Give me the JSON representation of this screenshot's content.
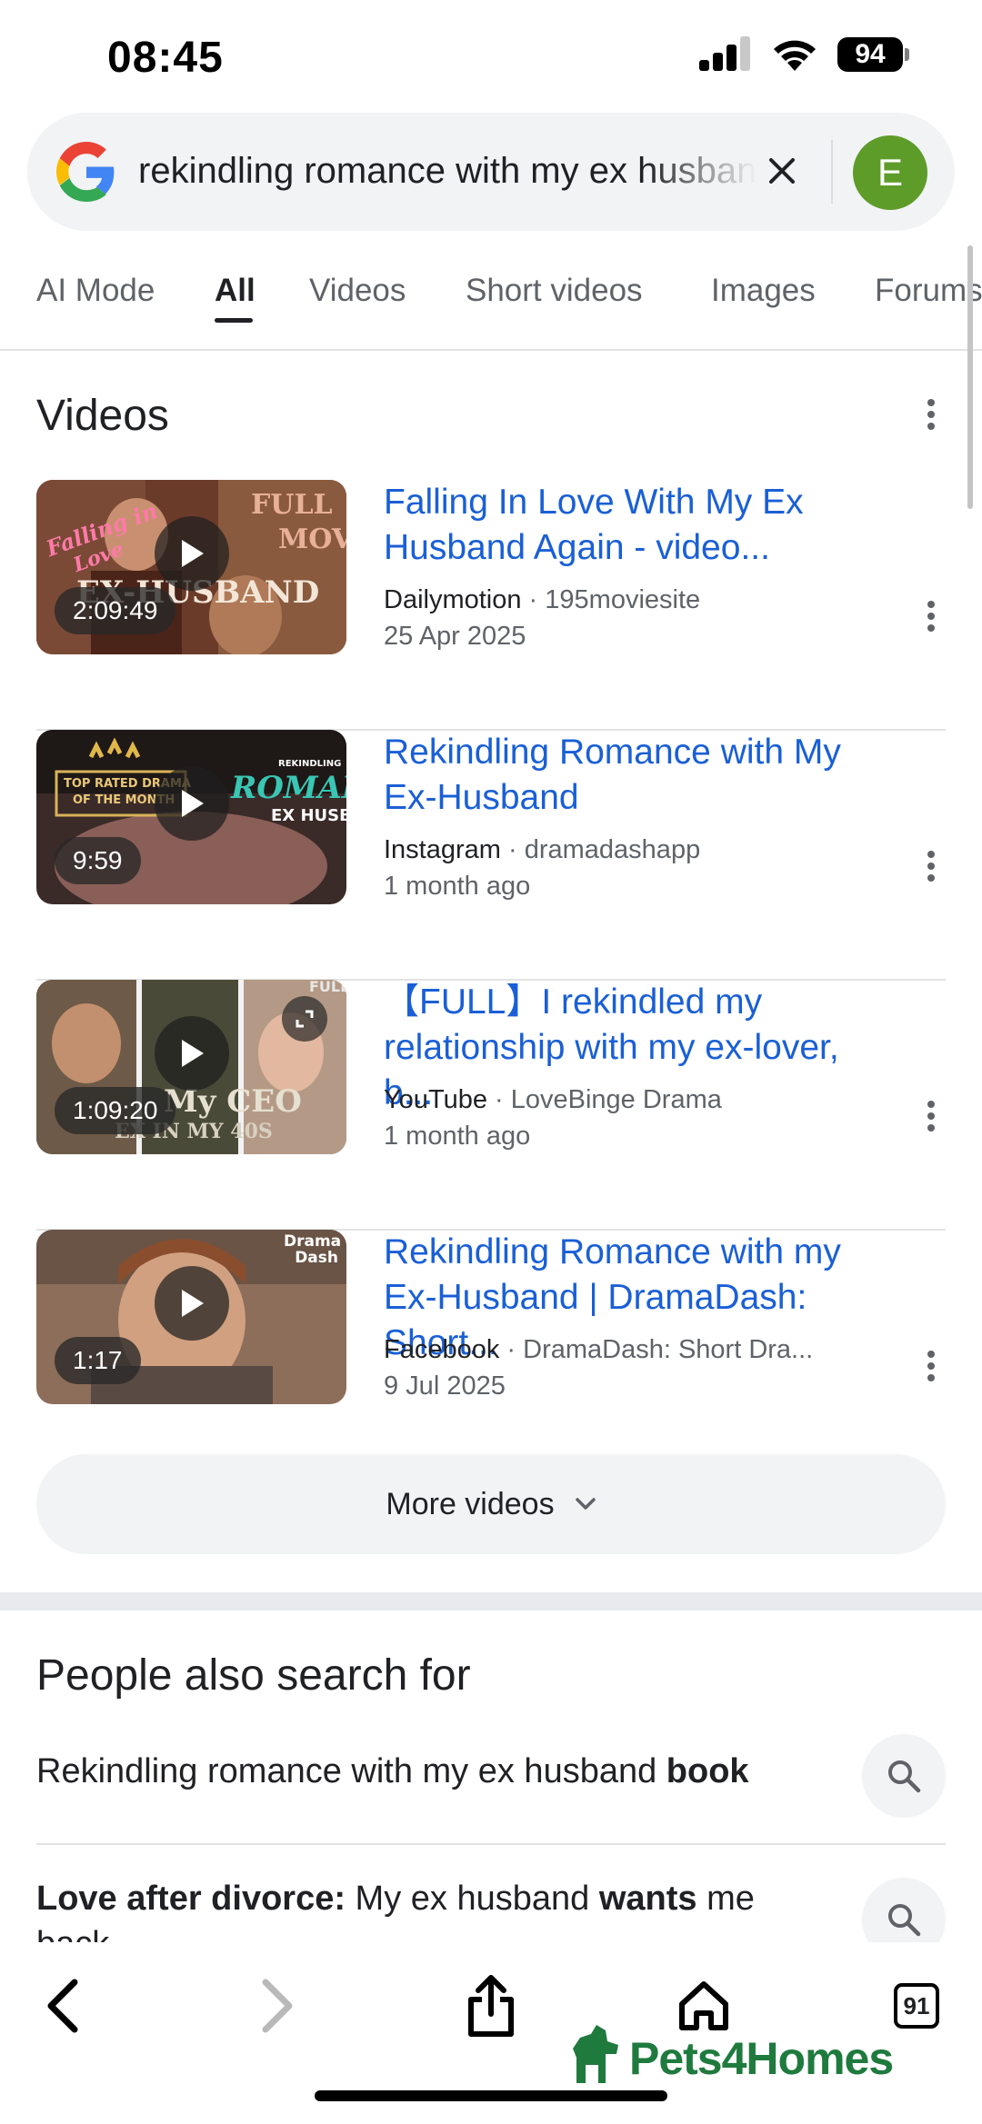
{
  "status_bar": {
    "time": "08:45",
    "battery": "94"
  },
  "search": {
    "query": "rekindling romance with my ex husband",
    "avatar_letter": "E"
  },
  "tabs": [
    "AI Mode",
    "All",
    "Videos",
    "Short videos",
    "Images",
    "Forums"
  ],
  "active_tab": "All",
  "videos_section": {
    "title": "Videos",
    "items": [
      {
        "title": "Falling In Love With My Ex Husband Again - video...",
        "source": "Dailymotion",
        "channel": " · 195moviesite",
        "date": "25 Apr 2025",
        "duration": "2:09:49"
      },
      {
        "title": "Rekindling Romance with My Ex-Husband",
        "source": "Instagram",
        "channel": " · dramadashapp",
        "date": "1 month ago",
        "duration": "9:59"
      },
      {
        "title": "【FULL】I rekindled my relationship with my ex-lover, b...",
        "source": "YouTube",
        "channel": " · LoveBinge Drama",
        "date": "1 month ago",
        "duration": "1:09:20"
      },
      {
        "title": "Rekindling Romance with my Ex-Husband | DramaDash: Short...",
        "source": "Facebook",
        "channel": " · DramaDash: Short Dra...",
        "date": "9 Jul 2025",
        "duration": "1:17"
      }
    ],
    "more_label": "More videos"
  },
  "thumb_text": {
    "t1_falling": "Falling in",
    "t1_love": "Love",
    "t1_full": "FULL",
    "t1_movie": "MOVIE",
    "t1_ex": "EX-HUSBAND",
    "t2_top": "TOP RATED DRAMA",
    "t2_month": "OF THE MONTH",
    "t2_rekindling": "REKINDLING",
    "t2_romance": "ROMANCE",
    "t2_ex": "EX HUSBAND",
    "t3_full": "FULL",
    "t3_ceo": "My CEO",
    "t3_ex": "EX IN MY 40S",
    "t4_brand": "Drama Dash"
  },
  "people_also_search": {
    "title": "People also search for",
    "items": [
      {
        "prefix": "",
        "bold1": "",
        "middle": "Rekindling romance with my ex husband ",
        "bold2": "book"
      },
      {
        "prefix": "",
        "bold1": "Love after divorce:",
        "middle": " My ex husband ",
        "bold2": "wants",
        "suffix": " me back"
      }
    ]
  },
  "watermark": "Pets4Homes",
  "bottom_bar": {
    "tabs_count": "91"
  },
  "colors": {
    "link": "#1a5fd6",
    "avatar": "#5e9c2a",
    "watermark": "#1f7a3e"
  }
}
